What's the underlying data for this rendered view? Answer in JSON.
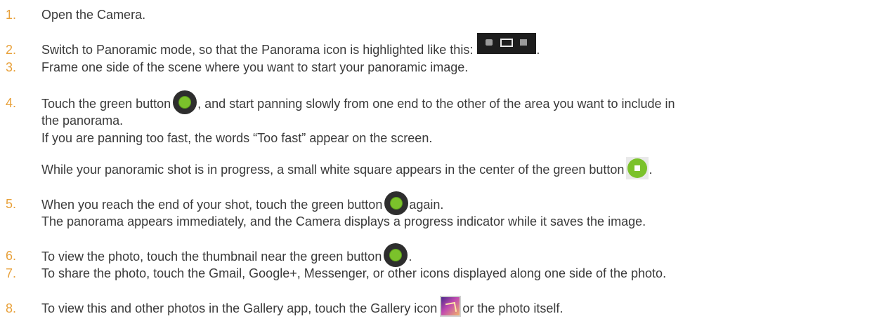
{
  "steps": [
    {
      "num": "1.",
      "text": "Open the Camera."
    },
    {
      "num": "2.",
      "text": "Switch to Panoramic mode, so that the Panorama icon is highlighted like this:",
      "tail": "."
    },
    {
      "num": "3.",
      "text": "Frame one side of the scene where you want to start your panoramic image."
    },
    {
      "num": "4.",
      "text_before": "Touch the green button",
      "text_after": ", and start panning slowly from one end to the other of the area you want to include in",
      "line2": "the panorama.",
      "line3": "If you are panning too fast, the words “Too fast” appear on the screen.",
      "line4": "While your panoramic shot is in progress, a small white square appears in the center of the green button",
      "line4_tail": "."
    },
    {
      "num": "5.",
      "text_before": "When you reach the end of your shot, touch the green button",
      "text_after": "again.",
      "line2": "The panorama appears immediately, and the Camera displays a progress indicator while it saves the image."
    },
    {
      "num": "6.",
      "text_before": "To view the photo, touch the thumbnail near the green button",
      "text_after": "."
    },
    {
      "num": "7.",
      "text": "To share the photo, touch the Gmail, Google+, Messenger, or other icons displayed along one side of the photo."
    },
    {
      "num": "8.",
      "text_before": "To view this and other photos in the Gallery app, touch the Gallery icon",
      "text_after": "or the photo itself."
    }
  ],
  "icons": {
    "green_button": "green-shutter-icon",
    "stop_button": "green-stop-icon",
    "mode_bar": "camera-mode-selector-icon",
    "gallery": "gallery-app-icon"
  },
  "colors": {
    "numbering": "#e8a13b",
    "text": "#3a3a3a",
    "green": "#7bc22b"
  }
}
